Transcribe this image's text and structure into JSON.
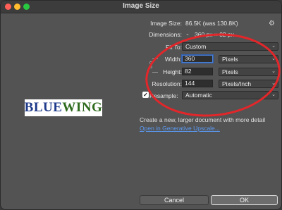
{
  "window": {
    "title": "Image Size"
  },
  "preview": {
    "logo_part1": "BLUE",
    "logo_part2": "WING"
  },
  "image_size": {
    "label": "Image Size:",
    "value": "86.5K (was 130.8K)"
  },
  "dimensions": {
    "label": "Dimensions:",
    "value": "360 px × 82 px"
  },
  "fit_to": {
    "label": "Fit To:",
    "value": "Custom"
  },
  "width": {
    "label": "Width:",
    "value": "360",
    "unit": "Pixels"
  },
  "height": {
    "label": "Height:",
    "value": "82",
    "unit": "Pixels"
  },
  "resolution": {
    "label": "Resolution:",
    "value": "144",
    "unit": "Pixels/Inch"
  },
  "resample": {
    "label": "Resample:",
    "value": "Automatic",
    "checked": true
  },
  "info_text": "Create a new, larger document with more detail",
  "upscale_link": "Open in Generative Upscale...",
  "buttons": {
    "cancel": "Cancel",
    "ok": "OK"
  },
  "colors": {
    "annotation_circle": "#e3262a",
    "link": "#5b9af5",
    "focus": "#4a7fd6"
  }
}
